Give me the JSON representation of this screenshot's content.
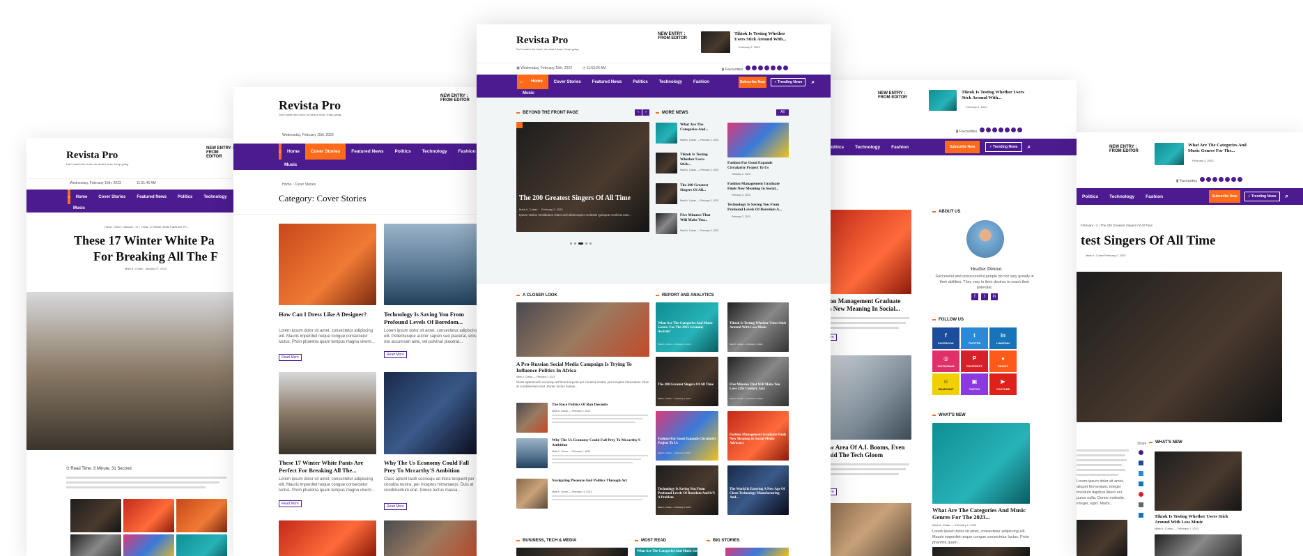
{
  "brand": {
    "name": "Revista Pro",
    "tagline": "Don't watch the clock; do what it does. Keep going."
  },
  "new_entry": {
    "label": "NEW ENTRY : FROM EDITOR",
    "title": "Tiktok Is Testing Whether Users Stick Around With...",
    "date": "February 2, 2023"
  },
  "date_bar": {
    "date": "Wednesday, February 15th, 2023",
    "time": "11:53:26 AM",
    "favourites": "Favourites"
  },
  "nav": {
    "items": [
      "Home",
      "Cover Stories",
      "Featured News",
      "Politics",
      "Technology",
      "Fashion",
      "Music"
    ],
    "subscribe": "Subscribe Now",
    "trending": "Trending News"
  },
  "left_screen": {
    "time": "11:51:46 AM",
    "date": "Wednesday, February 15th, 2023",
    "breadcrumb": "Home › 2023 › January › 27 › These 17 Winter White Pants Are Pe...",
    "title": "These 17 Winter White Pants Are Perfect For Breaking All The F...",
    "title_l1": "These 17 Winter White Pa",
    "title_l2": "For Breaking All The F",
    "author": "Mark A. Cuban",
    "post_date": "January 27, 2023",
    "read_time": "Read Time: 3 Minute, 31 Second"
  },
  "category_screen": {
    "breadcrumb": "Home › Cover Stories",
    "heading": "Category: Cover Stories",
    "posts": [
      {
        "title": "How Can I Dress Like A Designer?",
        "excerpt": "Lorem ipsum dolor sit amet, consectetur adipiscing elit. Mauris imperdiet neque congue consectetur luctus. Proin pharetra quam tempus magna viverri..."
      },
      {
        "title": "Technology Is Saving You From Profound Levels Of Boredom...",
        "excerpt": "Lorem ipsum dolor sit amet, consectetur adipiscing elit. Pellentesque auctor sapien sed placerat, eros nisi accumsan ante, vel pulvinar placerat..."
      },
      {
        "title": "These 17 Winter White Pants Are Perfect For Breaking All The...",
        "excerpt": "Lorem ipsum dolor sit amet, consectetur adipiscing elit. Mauris imperdiet neque congue consectetur luctus. Proin pharetra quam tempus magna viverri..."
      },
      {
        "title": "Why The Us Economy Could Fall Prey To Mccarthy'S Ambition",
        "excerpt": "Class aptent taciti sociosqu ad litora torquent per conubia nostra, per inceptos himenaeos. Duis at condimentum erat. Donec luctus massa..."
      }
    ],
    "read_more": "Read More"
  },
  "center_screen": {
    "sections": {
      "beyond": "BEYOND THE FRONT PAGE",
      "more_news": "MORE NEWS",
      "closer_look": "A CLOSER LOOK",
      "report": "REPORT AND ANALYTICS",
      "business": "BUSINESS, TECH & MEDIA",
      "most_read": "MOST READ",
      "big_stories": "BIG STORIES"
    },
    "all_label": "All",
    "hero": {
      "title": "The 200 Greatest Singers Of All Time",
      "author": "Mark A. Cuban",
      "date": "February 2, 2023",
      "excerpt": "Ipsum Varius Vestibulum Diam sed ullamcorper molestie Quisque morbi at cam..."
    },
    "more_news": [
      {
        "title": "What Are The Categories And...",
        "meta": "Mark A. Cuban — February 2, 2023"
      },
      {
        "title": "Tiktok Is Testing Whether Users Stick...",
        "meta": "Mark A. Cuban — February 2, 2023"
      },
      {
        "title": "The 200 Greatest Singers Of All...",
        "meta": "Mark A. Cuban — February 2, 2023"
      },
      {
        "title": "Five Minutes That Will Make You...",
        "meta": "Mark A. Cuban — February 2, 2023"
      }
    ],
    "more_right": [
      {
        "title": "Fashion For Good Expands Circularity Project To Us",
        "date": "February 2, 2023"
      },
      {
        "title": "Fashion Management Graduate Finds New Meaning In Social...",
        "date": "February 2, 2023"
      },
      {
        "title": "Technology Is Saving You From Profound Levels Of Boredom A...",
        "date": "February 2, 2023"
      }
    ],
    "closer": {
      "title": "A Pro-Russian Social Media Campaign Is Trying To Influence Politics In Africa",
      "meta": "Mark A. Cuban — February 2, 2023",
      "excerpt": "Class aptent taciti sociosqu ad litora torquent per conubia nostra, per inceptos himenaeos. Duis at condimentum erat. Donec luctus massa...",
      "list": [
        {
          "title": "The Race Politics Of Ron Desantis",
          "meta": "Mark A. Cuban — February 2, 2023"
        },
        {
          "title": "Why The Us Economy Could Fall Prey To Mccarthy'S Ambition",
          "meta": "Mark A. Cuban — February 1, 2023"
        },
        {
          "title": "Navigating Pleasure And Politics Through Art",
          "meta": "Mark A. Cuban — February 13, 2023"
        }
      ]
    },
    "report": [
      "What Are The Categories And Music Genres For The 2023 Grammy Awards?",
      "Tiktok Is Testing Whether Users Stick Around With Less Music",
      "The 200 Greatest Singers Of All Time",
      "Five Minutes That Will Make You Love 22St Century Jazz",
      "Fashion For Good Expands Circularity Project To Us",
      "Fashion Management Graduate Finds New Meaning In Social Media Advocacy",
      "Technology Is Saving You From Profound Levels Of Boredom And It'S A Problem",
      "The World Is Entering A New Age Of Clean Technology Manufacturing And..."
    ],
    "report_meta": "Mark A. Cuban — February 2, 2023",
    "bottom_teal": "What Are The Categories And Music Genres For The"
  },
  "right_screen": {
    "about": "ABOUT US",
    "person": "Heather Denton",
    "bio": "Successful and unsuccessful people do not vary greatly in their abilities. They vary in their desires to reach their potential.",
    "follow": "FOLLOW US",
    "social": [
      "FACEBOOK",
      "TWITTER",
      "LINKEDIN",
      "INSTAGRAM",
      "PINTEREST",
      "REDDIT",
      "SNAPCHAT",
      "TWITCH",
      "YOUTUBE"
    ],
    "whats_new": "WHAT'S NEW",
    "post1": "Fashion Management Graduate Finds New Meaning In Social...",
    "post1_l1": "shion Management Graduate",
    "post1_l2": "nds New Meaning In Social...",
    "post2": "A New Area Of A.I. Booms, Even Amid The Tech Gloom",
    "post2_l1": "New Area Of A.I. Booms, Even",
    "post2_l2": "Amid The Tech Gloom",
    "wn_title": "What Are The Categories And Music Genres For The 2023...",
    "wn_meta": "Mark A. Cuban — February 2, 2023",
    "excerpt": "Lorem ipsum dolor sit amet, consectetur adipiscing elit. Mauris imperdiet neque congue consectetur luctus. Proin pharetra quam...",
    "read_more": "Read More"
  },
  "far_right": {
    "breadcrumb": "February › 2 › The 200 Greatest Singers Of All Time",
    "title": "test Singers Of All Time",
    "author": "Mark A. Cuban",
    "date": "February 2, 2023",
    "share": "Share",
    "whats_new": "WHAT'S NEW",
    "wn_title": "Tiktok Is Testing Whether Users Stick Around With Less Music",
    "wn_meta": "Mark A. Cuban — February 2, 2023",
    "excerpt": "Lorem ipsum dolor sit amet, aliquet fermentum, integer tincidunt dapibus libero vel, purus nulla. Donec molestie, integer, eget. Morbi..."
  }
}
